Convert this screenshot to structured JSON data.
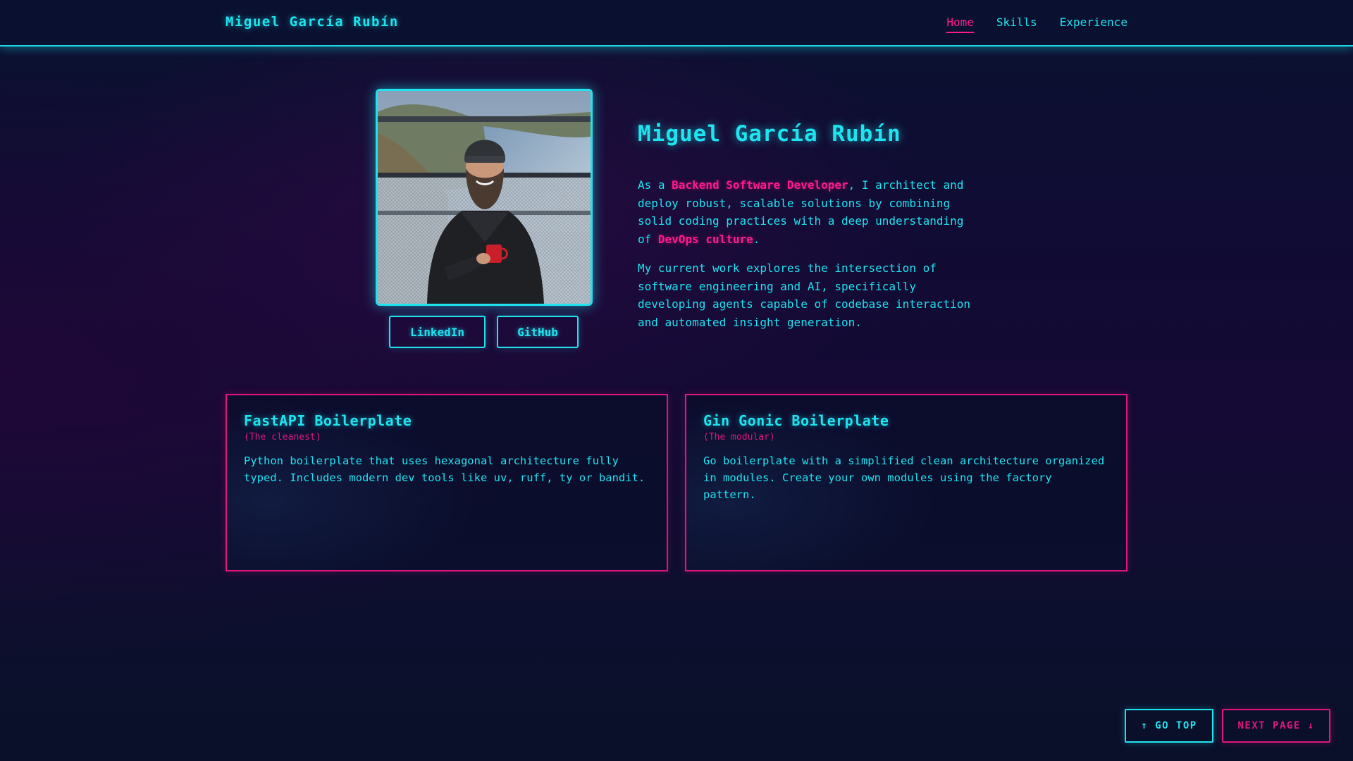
{
  "header": {
    "brand": "Miguel García Rubín",
    "nav": [
      {
        "label": "Home",
        "active": true
      },
      {
        "label": "Skills",
        "active": false
      },
      {
        "label": "Experience",
        "active": false
      }
    ]
  },
  "hero": {
    "photo_alt": "Profile photo of Miguel García Rubín",
    "social": {
      "linkedin_label": "LinkedIn",
      "github_label": "GitHub"
    },
    "name": "Miguel García Rubín",
    "bio1": {
      "before": "As a ",
      "highlight1": "Backend Software Developer",
      "middle": ", I architect and deploy robust, scalable solutions by combining solid coding practices with a deep understanding of ",
      "highlight2": "DevOps culture",
      "after": "."
    },
    "bio2": "My current work explores the intersection of software engineering and AI, specifically developing agents capable of codebase interaction and automated insight generation."
  },
  "projects": [
    {
      "title": "FastAPI Boilerplate",
      "subtitle": "(The cleanest)",
      "description": "Python boilerplate that uses hexagonal architecture fully typed. Includes modern dev tools like uv, ruff, ty or bandit."
    },
    {
      "title": "Gin Gonic Boilerplate",
      "subtitle": "(The modular)",
      "description": "Go boilerplate with a simplified clean architecture organized in modules. Create your own modules using the factory pattern."
    }
  ],
  "floating": {
    "go_top_label": "↑ GO TOP",
    "next_page_label": "NEXT PAGE ↓"
  },
  "colors": {
    "accent_cyan": "#1ee4f0",
    "accent_pink": "#ff1a8c",
    "background": "#110b34"
  }
}
